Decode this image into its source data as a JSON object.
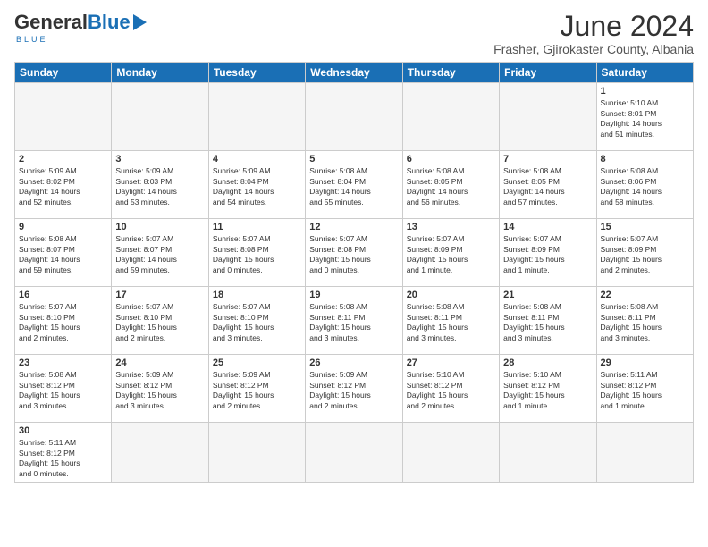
{
  "header": {
    "logo_general": "General",
    "logo_blue": "Blue",
    "title": "June 2024",
    "location": "Frasher, Gjirokaster County, Albania"
  },
  "weekdays": [
    "Sunday",
    "Monday",
    "Tuesday",
    "Wednesday",
    "Thursday",
    "Friday",
    "Saturday"
  ],
  "weeks": [
    [
      {
        "day": "",
        "empty": true
      },
      {
        "day": "",
        "empty": true
      },
      {
        "day": "",
        "empty": true
      },
      {
        "day": "",
        "empty": true
      },
      {
        "day": "",
        "empty": true
      },
      {
        "day": "",
        "empty": true
      },
      {
        "day": "1",
        "info": "Sunrise: 5:10 AM\nSunset: 8:01 PM\nDaylight: 14 hours\nand 51 minutes."
      }
    ],
    [
      {
        "day": "2",
        "info": "Sunrise: 5:09 AM\nSunset: 8:02 PM\nDaylight: 14 hours\nand 52 minutes."
      },
      {
        "day": "3",
        "info": "Sunrise: 5:09 AM\nSunset: 8:03 PM\nDaylight: 14 hours\nand 53 minutes."
      },
      {
        "day": "4",
        "info": "Sunrise: 5:09 AM\nSunset: 8:04 PM\nDaylight: 14 hours\nand 54 minutes."
      },
      {
        "day": "5",
        "info": "Sunrise: 5:08 AM\nSunset: 8:04 PM\nDaylight: 14 hours\nand 55 minutes."
      },
      {
        "day": "6",
        "info": "Sunrise: 5:08 AM\nSunset: 8:05 PM\nDaylight: 14 hours\nand 56 minutes."
      },
      {
        "day": "7",
        "info": "Sunrise: 5:08 AM\nSunset: 8:05 PM\nDaylight: 14 hours\nand 57 minutes."
      },
      {
        "day": "8",
        "info": "Sunrise: 5:08 AM\nSunset: 8:06 PM\nDaylight: 14 hours\nand 58 minutes."
      }
    ],
    [
      {
        "day": "9",
        "info": "Sunrise: 5:08 AM\nSunset: 8:07 PM\nDaylight: 14 hours\nand 59 minutes."
      },
      {
        "day": "10",
        "info": "Sunrise: 5:07 AM\nSunset: 8:07 PM\nDaylight: 14 hours\nand 59 minutes."
      },
      {
        "day": "11",
        "info": "Sunrise: 5:07 AM\nSunset: 8:08 PM\nDaylight: 15 hours\nand 0 minutes."
      },
      {
        "day": "12",
        "info": "Sunrise: 5:07 AM\nSunset: 8:08 PM\nDaylight: 15 hours\nand 0 minutes."
      },
      {
        "day": "13",
        "info": "Sunrise: 5:07 AM\nSunset: 8:09 PM\nDaylight: 15 hours\nand 1 minute."
      },
      {
        "day": "14",
        "info": "Sunrise: 5:07 AM\nSunset: 8:09 PM\nDaylight: 15 hours\nand 1 minute."
      },
      {
        "day": "15",
        "info": "Sunrise: 5:07 AM\nSunset: 8:09 PM\nDaylight: 15 hours\nand 2 minutes."
      }
    ],
    [
      {
        "day": "16",
        "info": "Sunrise: 5:07 AM\nSunset: 8:10 PM\nDaylight: 15 hours\nand 2 minutes."
      },
      {
        "day": "17",
        "info": "Sunrise: 5:07 AM\nSunset: 8:10 PM\nDaylight: 15 hours\nand 2 minutes."
      },
      {
        "day": "18",
        "info": "Sunrise: 5:07 AM\nSunset: 8:10 PM\nDaylight: 15 hours\nand 3 minutes."
      },
      {
        "day": "19",
        "info": "Sunrise: 5:08 AM\nSunset: 8:11 PM\nDaylight: 15 hours\nand 3 minutes."
      },
      {
        "day": "20",
        "info": "Sunrise: 5:08 AM\nSunset: 8:11 PM\nDaylight: 15 hours\nand 3 minutes."
      },
      {
        "day": "21",
        "info": "Sunrise: 5:08 AM\nSunset: 8:11 PM\nDaylight: 15 hours\nand 3 minutes."
      },
      {
        "day": "22",
        "info": "Sunrise: 5:08 AM\nSunset: 8:11 PM\nDaylight: 15 hours\nand 3 minutes."
      }
    ],
    [
      {
        "day": "23",
        "info": "Sunrise: 5:08 AM\nSunset: 8:12 PM\nDaylight: 15 hours\nand 3 minutes."
      },
      {
        "day": "24",
        "info": "Sunrise: 5:09 AM\nSunset: 8:12 PM\nDaylight: 15 hours\nand 3 minutes."
      },
      {
        "day": "25",
        "info": "Sunrise: 5:09 AM\nSunset: 8:12 PM\nDaylight: 15 hours\nand 2 minutes."
      },
      {
        "day": "26",
        "info": "Sunrise: 5:09 AM\nSunset: 8:12 PM\nDaylight: 15 hours\nand 2 minutes."
      },
      {
        "day": "27",
        "info": "Sunrise: 5:10 AM\nSunset: 8:12 PM\nDaylight: 15 hours\nand 2 minutes."
      },
      {
        "day": "28",
        "info": "Sunrise: 5:10 AM\nSunset: 8:12 PM\nDaylight: 15 hours\nand 1 minute."
      },
      {
        "day": "29",
        "info": "Sunrise: 5:11 AM\nSunset: 8:12 PM\nDaylight: 15 hours\nand 1 minute."
      }
    ],
    [
      {
        "day": "30",
        "info": "Sunrise: 5:11 AM\nSunset: 8:12 PM\nDaylight: 15 hours\nand 0 minutes.",
        "last": true
      },
      {
        "day": "",
        "empty": true,
        "last": true
      },
      {
        "day": "",
        "empty": true,
        "last": true
      },
      {
        "day": "",
        "empty": true,
        "last": true
      },
      {
        "day": "",
        "empty": true,
        "last": true
      },
      {
        "day": "",
        "empty": true,
        "last": true
      },
      {
        "day": "",
        "empty": true,
        "last": true
      }
    ]
  ]
}
